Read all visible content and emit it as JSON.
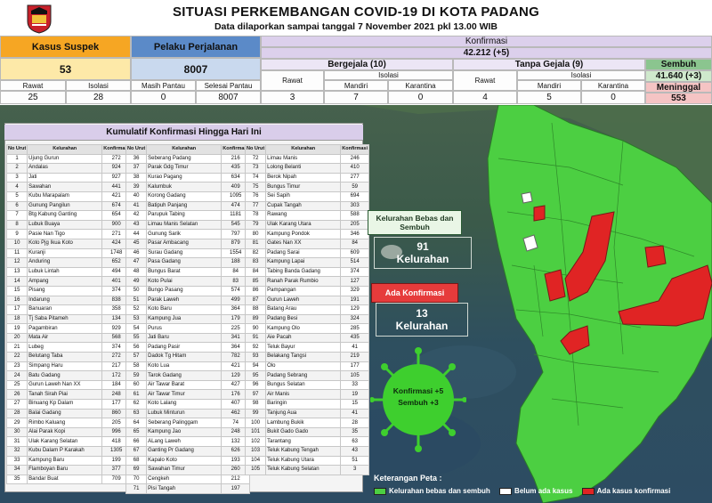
{
  "header": {
    "title": "SITUASI PERKEMBANGAN COVID-19 DI KOTA PADANG",
    "subtitle": "Data dilaporkan sampai tanggal 7 November 2021 pkl 13.00 WIB"
  },
  "stats": {
    "kasus_suspek": {
      "label": "Kasus Suspek",
      "value": "53",
      "rawat_label": "Rawat",
      "rawat": "25",
      "isolasi_label": "Isolasi",
      "isolasi": "28"
    },
    "pelaku_perjalanan": {
      "label": "Pelaku Perjalanan",
      "value": "8007",
      "masih_label": "Masih Pantau",
      "masih": "0",
      "selesai_label": "Selesai Pantau",
      "selesai": "8007"
    },
    "konfirmasi": {
      "label": "Konfirmasi",
      "value": "42.212 (+5)"
    },
    "bergejala": {
      "label": "Bergejala (10)",
      "rawat_label": "Rawat",
      "rawat": "3",
      "isolasi_label": "Isolasi",
      "mandiri_label": "Mandiri",
      "mandiri": "7",
      "karantina_label": "Karantina",
      "karantina": "0"
    },
    "tanpa_gejala": {
      "label": "Tanpa Gejala (9)",
      "rawat_label": "Rawat",
      "rawat": "4",
      "isolasi_label": "Isolasi",
      "mandiri_label": "Mandiri",
      "mandiri": "5",
      "karantina_label": "Karantina",
      "karantina": "0"
    },
    "sembuh": {
      "label": "Sembuh",
      "value": "41.640 (+3)"
    },
    "meninggal": {
      "label": "Meninggal",
      "value": "553"
    }
  },
  "kumulatif": {
    "title": "Kumulatif Konfirmasi Hingga Hari Ini",
    "col_no": "No Urut",
    "col_kel": "Kelurahan",
    "col_konf": "Konfirmasi",
    "groups": [
      [
        [
          "1",
          "Ujung Gurun",
          "272"
        ],
        [
          "2",
          "Andalas",
          "924"
        ],
        [
          "3",
          "Jati",
          "927"
        ],
        [
          "4",
          "Sawahan",
          "441"
        ],
        [
          "5",
          "Kubu Marapalam",
          "421"
        ],
        [
          "6",
          "Gunung Pangilun",
          "674"
        ],
        [
          "7",
          "Btg Kabung Ganting",
          "654"
        ],
        [
          "8",
          "Lubuk Buaya",
          "900"
        ],
        [
          "9",
          "Pasie Nan Tigo",
          "271"
        ],
        [
          "10",
          "Koto Pjg Ikua Koto",
          "424"
        ],
        [
          "11",
          "Kuranji",
          "1748"
        ],
        [
          "12",
          "Anduring",
          "652"
        ],
        [
          "13",
          "Lubuk Lintah",
          "494"
        ],
        [
          "14",
          "Ampang",
          "401"
        ],
        [
          "15",
          "Pisang",
          "374"
        ],
        [
          "16",
          "Indarung",
          "838"
        ],
        [
          "17",
          "Banuaran",
          "358"
        ],
        [
          "18",
          "Tj Saba Pitameh",
          "134"
        ],
        [
          "19",
          "Pagambiran",
          "929"
        ],
        [
          "20",
          "Mata Air",
          "568"
        ],
        [
          "21",
          "Lubeg",
          "374"
        ],
        [
          "22",
          "Belutang Taba",
          "272"
        ],
        [
          "23",
          "Simpang Haru",
          "217"
        ],
        [
          "24",
          "Batu Gadang",
          "172"
        ],
        [
          "25",
          "Gurun Laweh Nan XX",
          "184"
        ],
        [
          "26",
          "Tanah Sirah Piai",
          "248"
        ],
        [
          "27",
          "Binuang Kp Dalam",
          "177"
        ],
        [
          "28",
          "Balai Gadang",
          "860"
        ],
        [
          "29",
          "Rimbo Kaluang",
          "205"
        ],
        [
          "30",
          "Alai Parak Kopi",
          "996"
        ],
        [
          "31",
          "Ulak Karang Selatan",
          "418"
        ],
        [
          "32",
          "Kubu Dalam P Karakah",
          "1305"
        ],
        [
          "33",
          "Kampung Baru",
          "199"
        ],
        [
          "34",
          "Flamboyan Baru",
          "377"
        ],
        [
          "35",
          "Bandar Buat",
          "709"
        ]
      ],
      [
        [
          "36",
          "Seberang Padang",
          "216"
        ],
        [
          "37",
          "Parak Gdg Timur",
          "435"
        ],
        [
          "38",
          "Kurao Pagang",
          "634"
        ],
        [
          "39",
          "Kalumbuk",
          "409"
        ],
        [
          "40",
          "Korong Gadang",
          "1095"
        ],
        [
          "41",
          "Batipuh Panjang",
          "474"
        ],
        [
          "42",
          "Parupuk Tabing",
          "1181"
        ],
        [
          "43",
          "Limau Manis Selatan",
          "545"
        ],
        [
          "44",
          "Gunung Sarik",
          "797"
        ],
        [
          "45",
          "Pasar Ambacang",
          "879"
        ],
        [
          "46",
          "Surau Gadang",
          "1554"
        ],
        [
          "47",
          "Pasa Gadang",
          "188"
        ],
        [
          "48",
          "Bungus Barat",
          "84"
        ],
        [
          "49",
          "Koto Pulai",
          "83"
        ],
        [
          "50",
          "Bungo Pasang",
          "574"
        ],
        [
          "51",
          "Parak Laweh",
          "499"
        ],
        [
          "52",
          "Koto Baru",
          "364"
        ],
        [
          "53",
          "Kampung Jua",
          "179"
        ],
        [
          "54",
          "Purus",
          "225"
        ],
        [
          "55",
          "Jati Baru",
          "341"
        ],
        [
          "56",
          "Padang Pasir",
          "364"
        ],
        [
          "57",
          "Dadok Tg Hitam",
          "782"
        ],
        [
          "58",
          "Koto Lua",
          "421"
        ],
        [
          "59",
          "Tarok Gadang",
          "129"
        ],
        [
          "60",
          "Air Tawar Barat",
          "427"
        ],
        [
          "61",
          "Air Tawar Timur",
          "176"
        ],
        [
          "62",
          "Koto Lalang",
          "407"
        ],
        [
          "63",
          "Lubuk Minturun",
          "462"
        ],
        [
          "64",
          "Seberang Palinggam",
          "74"
        ],
        [
          "65",
          "Kampung Jao",
          "248"
        ],
        [
          "66",
          "ALang Laweh",
          "132"
        ],
        [
          "67",
          "Ganting Pr Gadang",
          "626"
        ],
        [
          "68",
          "Kapalo Koto",
          "193"
        ],
        [
          "69",
          "Sawahan Timur",
          "260"
        ],
        [
          "70",
          "Cengkeh",
          "212"
        ],
        [
          "71",
          "Pisi Tangah",
          "197"
        ]
      ],
      [
        [
          "72",
          "Limau Manis",
          "246"
        ],
        [
          "73",
          "Lolong Belanti",
          "410"
        ],
        [
          "74",
          "Berok Nipah",
          "277"
        ],
        [
          "75",
          "Bungus Timur",
          "59"
        ],
        [
          "76",
          "Sei Sapih",
          "694"
        ],
        [
          "77",
          "Cupak Tangah",
          "303"
        ],
        [
          "78",
          "Rawang",
          "588"
        ],
        [
          "79",
          "Ulak Karang Utara",
          "205"
        ],
        [
          "80",
          "Kampung Pondok",
          "346"
        ],
        [
          "81",
          "Gates Nan XX",
          "84"
        ],
        [
          "82",
          "Padang Sarai",
          "609"
        ],
        [
          "83",
          "Kampung Lapai",
          "514"
        ],
        [
          "84",
          "Tabing Banda Gadang",
          "374"
        ],
        [
          "85",
          "Ranah Parak Rumbio",
          "127"
        ],
        [
          "86",
          "Pampangan",
          "329"
        ],
        [
          "87",
          "Gurun Laweh",
          "191"
        ],
        [
          "88",
          "Batang Arau",
          "129"
        ],
        [
          "89",
          "Padang Besi",
          "324"
        ],
        [
          "90",
          "Kampung Olo",
          "285"
        ],
        [
          "91",
          "Aie Pacah",
          "435"
        ],
        [
          "92",
          "Teluk Bayur",
          "41"
        ],
        [
          "93",
          "Belakang Tangsi",
          "219"
        ],
        [
          "94",
          "Olo",
          "177"
        ],
        [
          "95",
          "Padang Sebrang",
          "105"
        ],
        [
          "96",
          "Bungus Selatan",
          "33"
        ],
        [
          "97",
          "Air Manis",
          "19"
        ],
        [
          "98",
          "Baringin",
          "15"
        ],
        [
          "99",
          "Tanjung Aua",
          "41"
        ],
        [
          "100",
          "Lambung Bukik",
          "28"
        ],
        [
          "101",
          "Bukit Gado Gado",
          "35"
        ],
        [
          "102",
          "Tarantang",
          "63"
        ],
        [
          "103",
          "Teluk Kabung Tengah",
          "43"
        ],
        [
          "104",
          "Teluk Kabung Utara",
          "51"
        ],
        [
          "105",
          "Teluk Kabung Selatan",
          "3"
        ]
      ]
    ]
  },
  "map": {
    "bebas_title": "Kelurahan Bebas dan Sembuh",
    "bebas_value": "91",
    "bebas_unit": "Kelurahan",
    "konf_title": "Ada Konfirmasi",
    "konf_value": "13",
    "konf_unit": "Kelurahan",
    "virus_line1": "Konfirmasi +5",
    "virus_line2": "Sembuh +3"
  },
  "legend": {
    "title": "Keterangan Peta :",
    "green": "Kelurahan bebas dan sembuh",
    "white": "Belum ada kasus",
    "red": "Ada kasus konfirmasi"
  },
  "colors": {
    "green": "#4ccf42",
    "red": "#e02424",
    "orange": "#f6a623",
    "purple": "#d9cdea"
  }
}
